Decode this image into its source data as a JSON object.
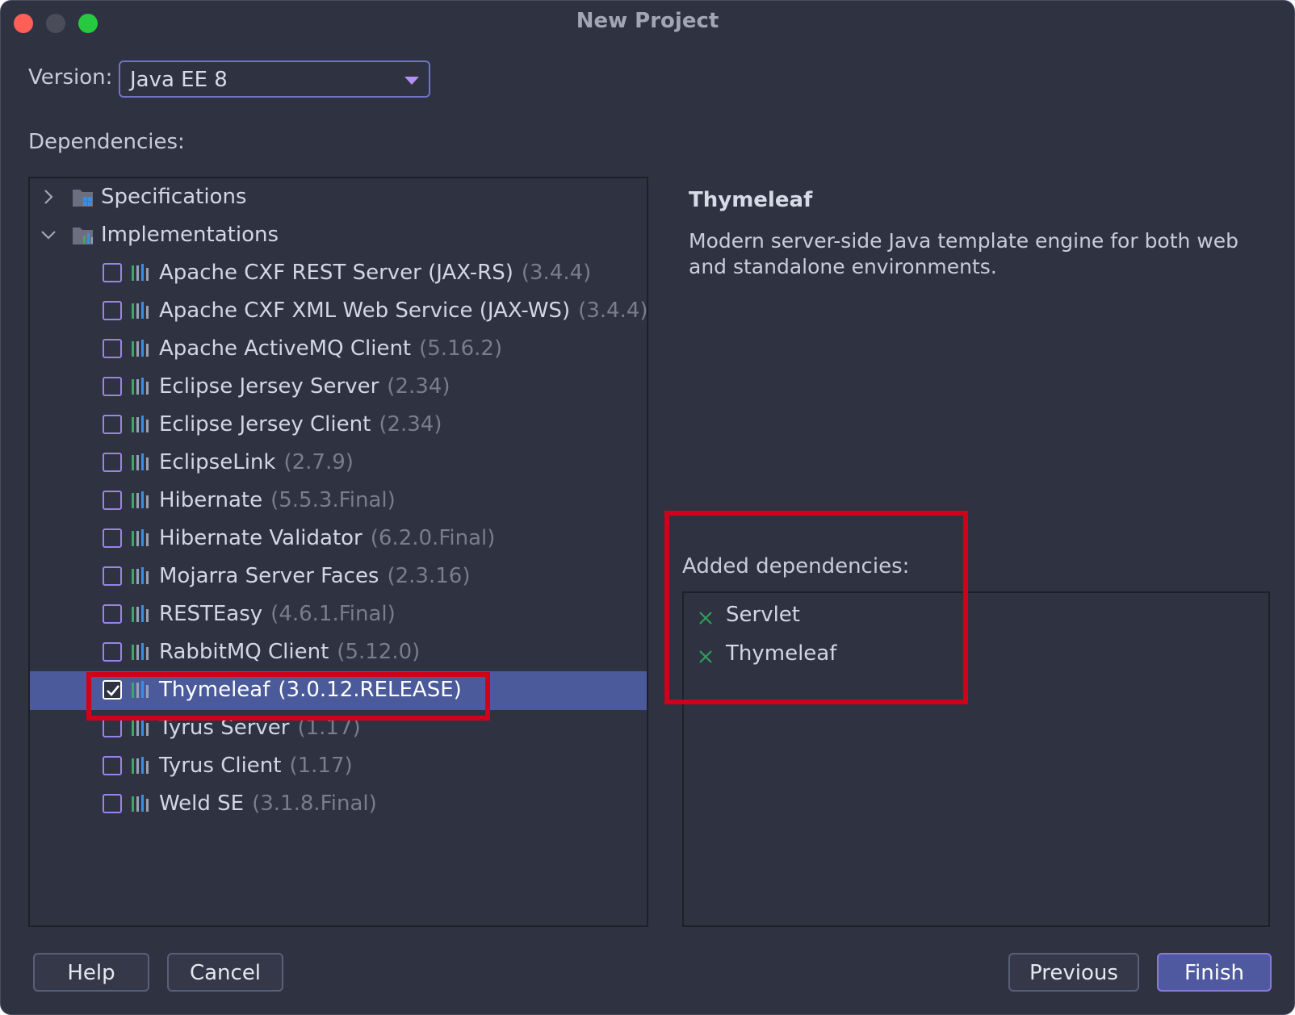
{
  "window": {
    "title": "New Project"
  },
  "version": {
    "label": "Version:",
    "value": "Java EE 8"
  },
  "dependencies": {
    "label": "Dependencies:",
    "groups": [
      {
        "label": "Specifications",
        "expanded": false,
        "icon": "folder-spec-icon"
      },
      {
        "label": "Implementations",
        "expanded": true,
        "icon": "folder-impl-icon"
      }
    ],
    "items": [
      {
        "name": "Apache CXF REST Server (JAX-RS)",
        "version": "(3.4.4)",
        "checked": false
      },
      {
        "name": "Apache CXF XML Web Service (JAX-WS)",
        "version": "(3.4.4)",
        "checked": false
      },
      {
        "name": "Apache ActiveMQ Client",
        "version": "(5.16.2)",
        "checked": false
      },
      {
        "name": "Eclipse Jersey Server",
        "version": "(2.34)",
        "checked": false
      },
      {
        "name": "Eclipse Jersey Client",
        "version": "(2.34)",
        "checked": false
      },
      {
        "name": "EclipseLink",
        "version": "(2.7.9)",
        "checked": false
      },
      {
        "name": "Hibernate",
        "version": "(5.5.3.Final)",
        "checked": false
      },
      {
        "name": "Hibernate Validator",
        "version": "(6.2.0.Final)",
        "checked": false
      },
      {
        "name": "Mojarra Server Faces",
        "version": "(2.3.16)",
        "checked": false
      },
      {
        "name": "RESTEasy",
        "version": "(4.6.1.Final)",
        "checked": false
      },
      {
        "name": "RabbitMQ Client",
        "version": "(5.12.0)",
        "checked": false
      },
      {
        "name": "Thymeleaf",
        "version": "(3.0.12.RELEASE)",
        "checked": true,
        "selected": true
      },
      {
        "name": "Tyrus Server",
        "version": "(1.17)",
        "checked": false
      },
      {
        "name": "Tyrus Client",
        "version": "(1.17)",
        "checked": false
      },
      {
        "name": "Weld SE",
        "version": "(3.1.8.Final)",
        "checked": false
      }
    ]
  },
  "description": {
    "title": "Thymeleaf",
    "text": "Modern server-side Java template engine for both web and standalone environments."
  },
  "added": {
    "label": "Added dependencies:",
    "items": [
      "Servlet",
      "Thymeleaf"
    ]
  },
  "buttons": {
    "help": "Help",
    "cancel": "Cancel",
    "previous": "Previous",
    "finish": "Finish"
  },
  "colors": {
    "accent": "#6f74c6",
    "selection": "#4b5a9a",
    "highlight": "#d0021b",
    "remove_x": "#2e9e5a"
  }
}
